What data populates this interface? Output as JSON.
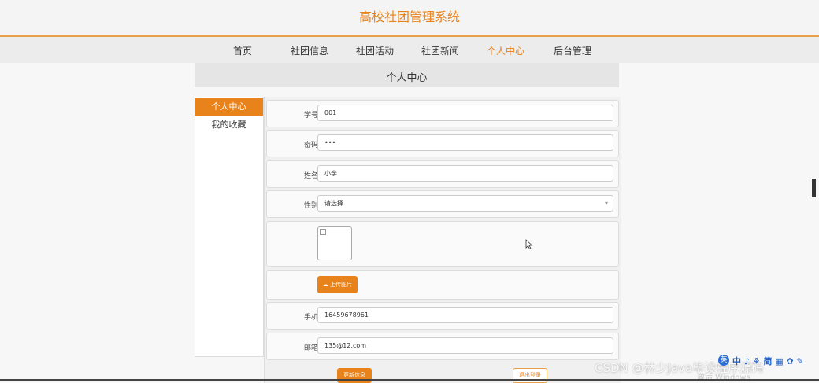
{
  "site": {
    "title": "高校社团管理系统"
  },
  "nav": {
    "items": [
      {
        "label": "首页"
      },
      {
        "label": "社团信息"
      },
      {
        "label": "社团活动"
      },
      {
        "label": "社团新闻"
      },
      {
        "label": "个人中心",
        "active": true
      },
      {
        "label": "后台管理"
      }
    ]
  },
  "page": {
    "heading": "个人中心"
  },
  "sidebar": {
    "items": [
      {
        "label": "个人中心",
        "active": true
      },
      {
        "label": "我的收藏"
      }
    ]
  },
  "form": {
    "student_id": {
      "label": "学号",
      "value": "001"
    },
    "password": {
      "label": "密码",
      "value": "•••"
    },
    "name": {
      "label": "姓名",
      "value": "小李"
    },
    "gender": {
      "label": "性别",
      "value": "请选择"
    },
    "upload_label": "上传图片",
    "phone": {
      "label": "手机",
      "value": "16459678961"
    },
    "email": {
      "label": "邮箱",
      "value": "135@12.com"
    },
    "save_label": "更新信息",
    "logout_label": "退出登录"
  },
  "overlay": {
    "watermark": "CSDN @林少Java毕设程序源码",
    "windows_watermark": "激活 Windows",
    "logo_badge": "英",
    "logo_text": "中 ♪ ⚘ 简 ▦ ✿ ✎"
  },
  "colors": {
    "accent": "#e8821a"
  }
}
